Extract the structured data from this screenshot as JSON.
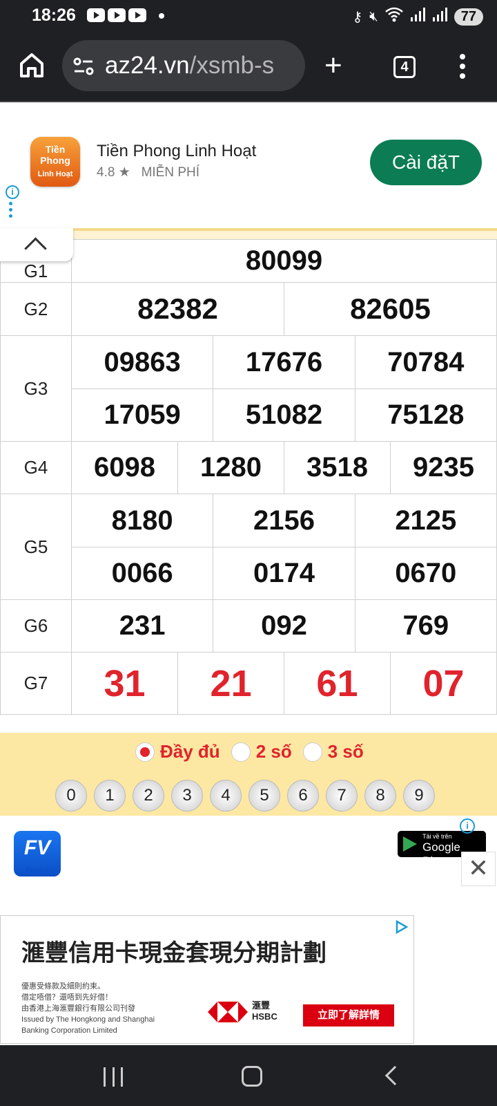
{
  "status_bar": {
    "time": "18:26",
    "battery": "77"
  },
  "browser": {
    "url_host": "az24.vn",
    "url_path": "/xsmb-s",
    "tab_count": "4"
  },
  "app_ad": {
    "logo_text_1": "Tiền",
    "logo_text_2": "Phong",
    "logo_text_3": "Linh Hoạt",
    "name": "Tiền Phong Linh Hoạt",
    "rating": "4.8 ★",
    "price": "MIỄN PHÍ",
    "install_label": "Cài đặT"
  },
  "results": {
    "g1": {
      "label": "G1",
      "numbers": [
        "80099"
      ]
    },
    "g2": {
      "label": "G2",
      "numbers": [
        "82382",
        "82605"
      ]
    },
    "g3": {
      "label": "G3",
      "numbers": [
        "09863",
        "17676",
        "70784",
        "17059",
        "51082",
        "75128"
      ]
    },
    "g4": {
      "label": "G4",
      "numbers": [
        "6098",
        "1280",
        "3518",
        "9235"
      ]
    },
    "g5": {
      "label": "G5",
      "numbers": [
        "8180",
        "2156",
        "2125",
        "0066",
        "0174",
        "0670"
      ]
    },
    "g6": {
      "label": "G6",
      "numbers": [
        "231",
        "092",
        "769"
      ]
    },
    "g7": {
      "label": "G7",
      "numbers": [
        "31",
        "21",
        "61",
        "07"
      ]
    }
  },
  "filter": {
    "options": [
      "Đầy đủ",
      "2 số",
      "3 số"
    ],
    "selected": "Đầy đủ",
    "digits": [
      "0",
      "1",
      "2",
      "3",
      "4",
      "5",
      "6",
      "7",
      "8",
      "9"
    ]
  },
  "fin_ad": {
    "logo_label": "FinVui",
    "store_small": "Tải về trên",
    "store_big": "Google Play",
    "close": "✕"
  },
  "hsbc_ad": {
    "title": "滙豐信用卡現金套現分期計劃",
    "fine_1": "優惠受條款及細則約束。",
    "fine_2": "借定唔借？還唔到先好借！",
    "fine_3": "由香港上海滙豐銀行有限公司刊發",
    "fine_4": "Issued by The Hongkong and Shanghai",
    "fine_5": "Banking Corporation Limited",
    "brand_cn": "滙豐",
    "brand_en": "HSBC",
    "cta": "立即了解詳情"
  },
  "colors": {
    "accent_red": "#e0232c",
    "install_green": "#0b7c53",
    "filter_bg": "#fde8a3"
  }
}
